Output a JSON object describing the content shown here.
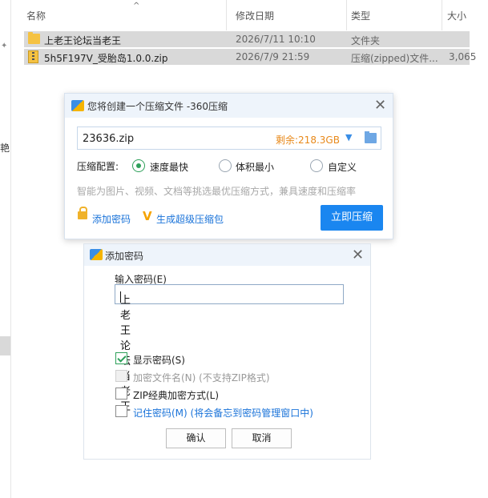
{
  "explorer": {
    "columns": {
      "name": "名称",
      "modified": "修改日期",
      "type": "类型",
      "size": "大小"
    },
    "left_fragment": "艳",
    "rows": [
      {
        "name": "上老王论坛当老王",
        "modified": "2026/7/11 10:10",
        "type": "文件夹",
        "size": "",
        "icon": "folder-icon"
      },
      {
        "name": "5h5F197V_受胎岛1.0.0.zip",
        "modified": "2026/7/9 21:59",
        "type": "压缩(zipped)文件...",
        "size": "3,065",
        "icon": "zip-icon"
      }
    ]
  },
  "compress_dialog": {
    "title": "您将创建一个压缩文件 -360压缩",
    "filename": "23636.zip",
    "space_left": "剩余:218.3GB",
    "config_label": "压缩配置:",
    "options": [
      "速度最快",
      "体积最小",
      "自定义"
    ],
    "selected_option": "速度最快",
    "hint": "智能为图片、视频、文档等挑选最优压缩方式，兼具速度和压缩率",
    "add_password": "添加密码",
    "super_package": "生成超级压缩包",
    "compress_now": "立即压缩",
    "accent_color": "#1a86f0"
  },
  "password_dialog": {
    "title": "添加密码",
    "input_label": "输入密码(E)",
    "password_value": "上老王论坛当老王",
    "checkboxes": [
      {
        "label": "显示密码(S)",
        "checked": true,
        "enabled": true
      },
      {
        "label": "加密文件名(N) (不支持ZIP格式)",
        "checked": false,
        "enabled": false
      },
      {
        "label": "ZIP经典加密方式(L)",
        "checked": false,
        "enabled": true
      },
      {
        "label": "记住密码(M) (将会备忘到密码管理窗口中)",
        "checked": false,
        "enabled": true
      }
    ],
    "ok": "确认",
    "cancel": "取消"
  }
}
